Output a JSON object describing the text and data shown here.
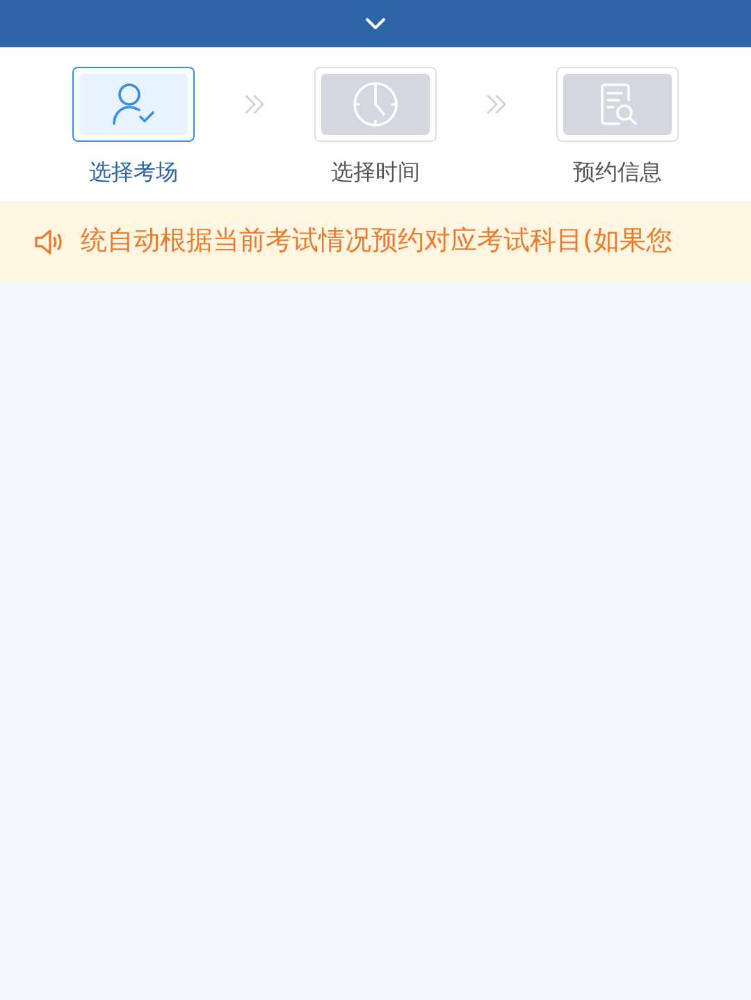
{
  "steps": [
    {
      "label": "选择考场",
      "kind": "person",
      "selected": true
    },
    {
      "label": "选择时间",
      "kind": "clock",
      "selected": false
    },
    {
      "label": "预约信息",
      "kind": "document",
      "selected": false
    }
  ],
  "notice": {
    "text": "统自动根据当前考试情况预约对应考试科目(如果您"
  }
}
